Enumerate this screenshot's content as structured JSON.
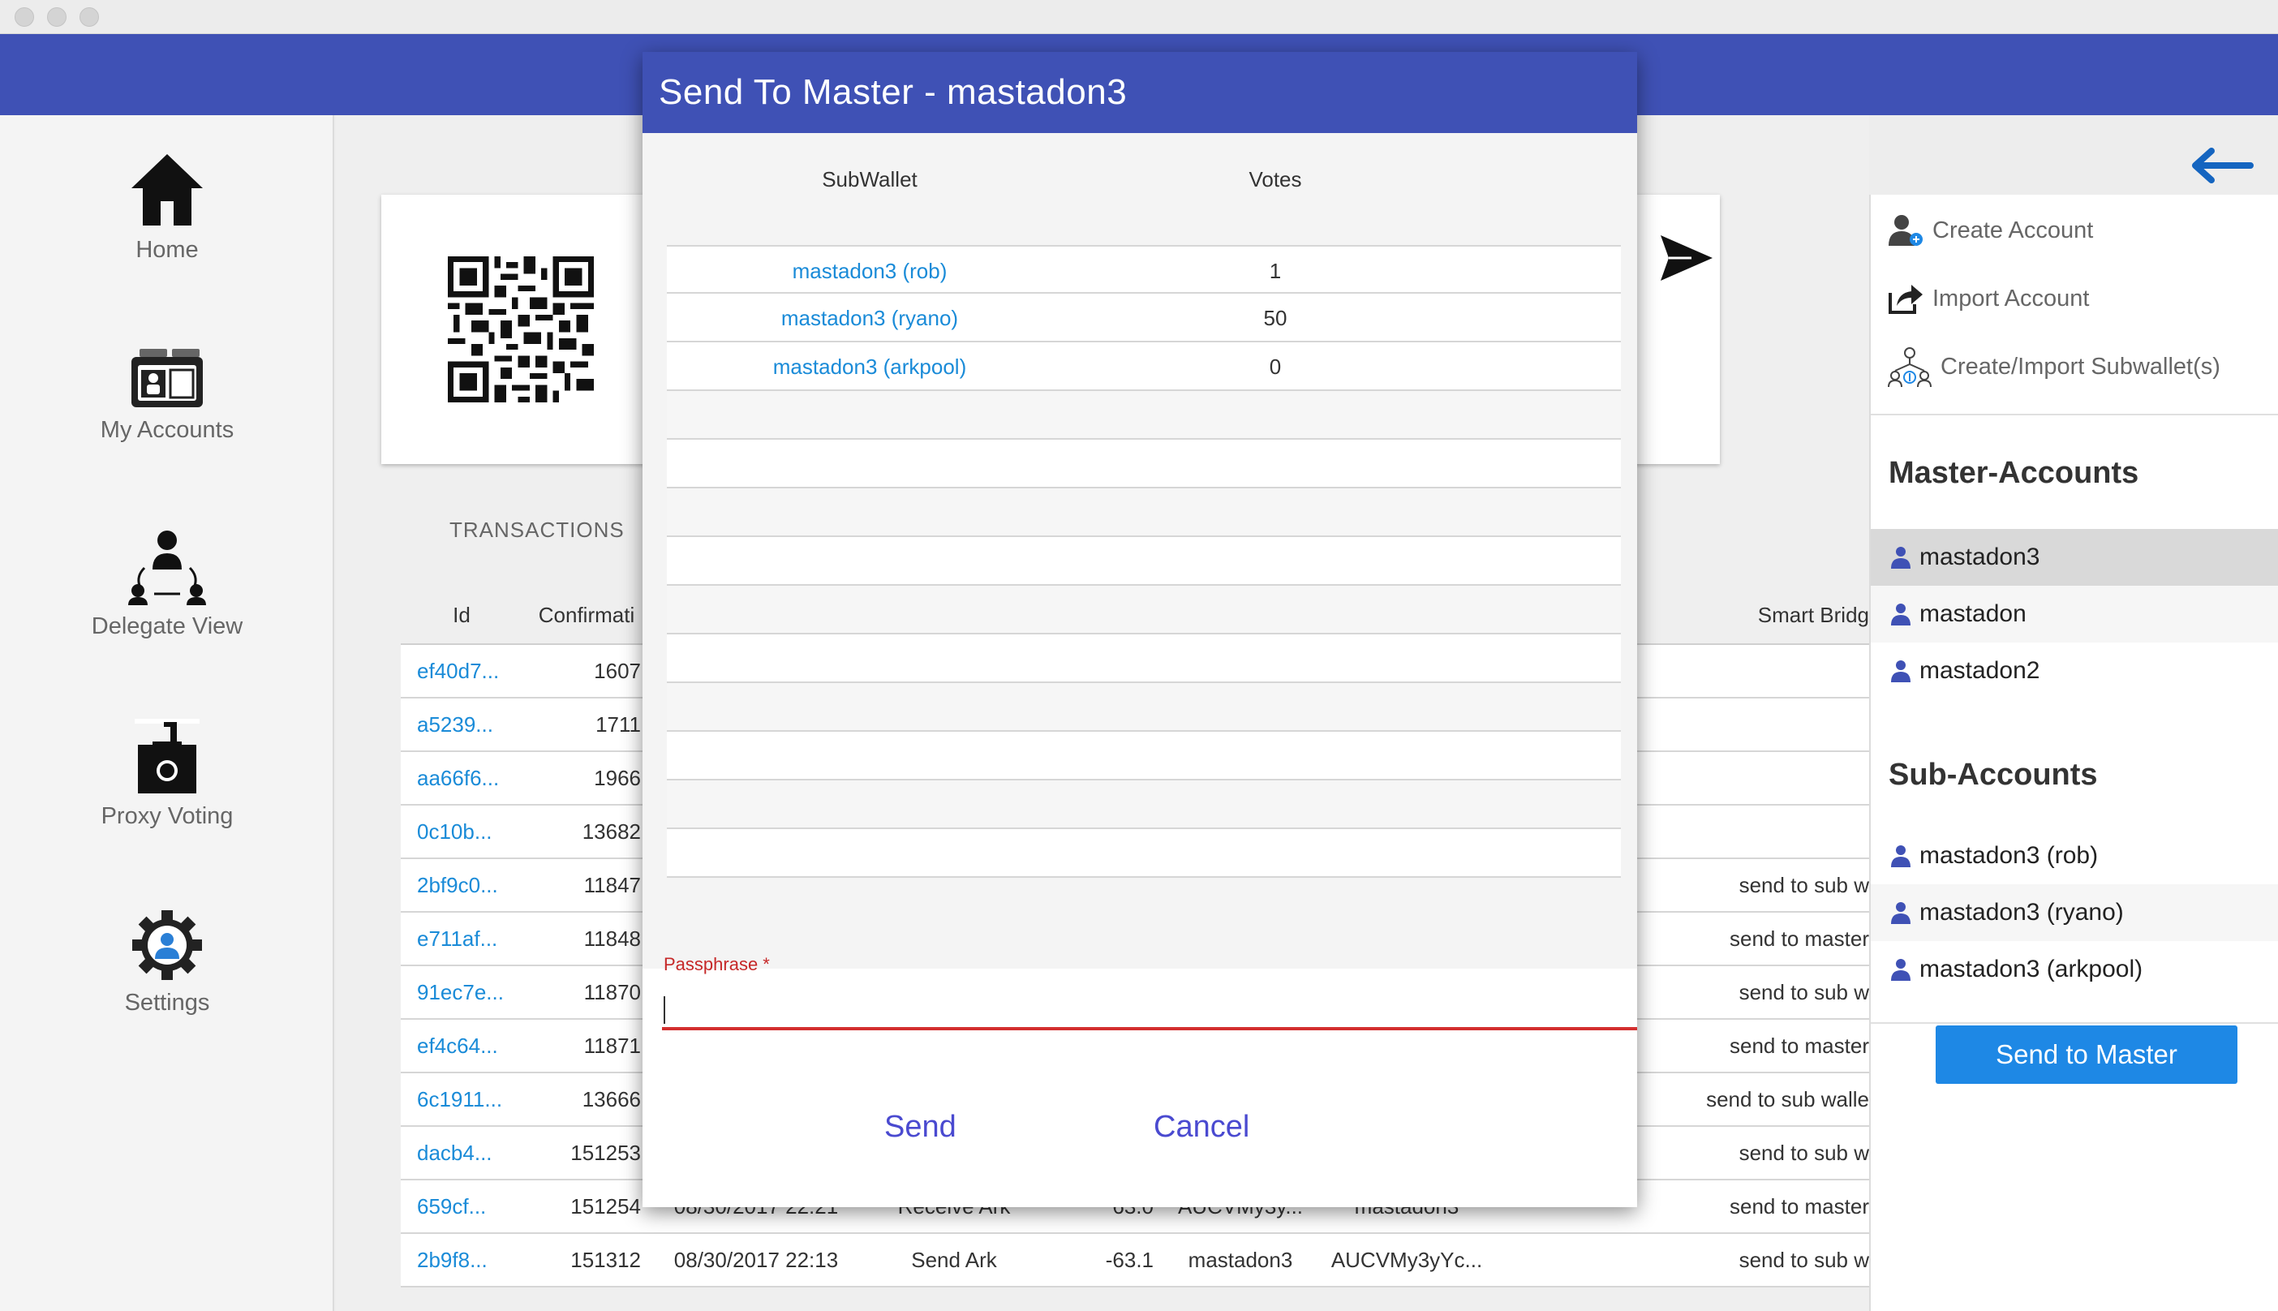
{
  "window": {
    "title": ""
  },
  "nav": [
    {
      "key": "home",
      "label": "Home",
      "icon": "house-icon"
    },
    {
      "key": "my-accounts",
      "label": "My Accounts",
      "icon": "id-card-icon"
    },
    {
      "key": "delegate-view",
      "label": "Delegate View",
      "icon": "delegate-network-icon"
    },
    {
      "key": "proxy-voting",
      "label": "Proxy Voting",
      "icon": "ballot-box-icon"
    },
    {
      "key": "settings",
      "label": "Settings",
      "icon": "gear-user-icon"
    }
  ],
  "main": {
    "transactions_title": "TRANSACTIONS",
    "columns": [
      "Id",
      "Confirmati",
      "",
      "",
      "",
      "",
      "",
      "Smart Bridg"
    ],
    "rows": [
      {
        "id": "ef40d7...",
        "conf": "1607",
        "date": "",
        "type": "",
        "amount": "",
        "from": "",
        "to": "",
        "bridge": ""
      },
      {
        "id": "a5239...",
        "conf": "1711",
        "date": "",
        "type": "",
        "amount": "",
        "from": "",
        "to": "",
        "bridge": ""
      },
      {
        "id": "aa66f6...",
        "conf": "1966",
        "date": "",
        "type": "",
        "amount": "",
        "from": "",
        "to": "",
        "bridge": ""
      },
      {
        "id": "0c10b...",
        "conf": "13682",
        "date": "",
        "type": "",
        "amount": "",
        "from": "",
        "to": "",
        "bridge": ""
      },
      {
        "id": "2bf9c0...",
        "conf": "11847",
        "date": "",
        "type": "",
        "amount": "",
        "from": "",
        "to": ".",
        "bridge": "send to sub w"
      },
      {
        "id": "e711af...",
        "conf": "11848",
        "date": "",
        "type": "",
        "amount": "",
        "from": "",
        "to": "",
        "bridge": "send to master"
      },
      {
        "id": "91ec7e...",
        "conf": "11870",
        "date": "",
        "type": "",
        "amount": "",
        "from": "",
        "to": ".",
        "bridge": "send to sub w"
      },
      {
        "id": "ef4c64...",
        "conf": "11871",
        "date": "",
        "type": "",
        "amount": "",
        "from": "",
        "to": "",
        "bridge": "send to master"
      },
      {
        "id": "6c1911...",
        "conf": "13666",
        "date": "",
        "type": "",
        "amount": "",
        "from": "",
        "to": "..",
        "bridge": "send to sub walle"
      },
      {
        "id": "dacb4...",
        "conf": "151253",
        "date": "",
        "type": "",
        "amount": "",
        "from": "",
        "to": ".",
        "bridge": "send to sub w"
      },
      {
        "id": "659cf...",
        "conf": "151254",
        "date": "08/30/2017 22:21",
        "type": "Receive Ark",
        "amount": "63.0",
        "from": "AUCVMy3y...",
        "to": "mastadon3",
        "bridge": "send to master"
      },
      {
        "id": "2b9f8...",
        "conf": "151312",
        "date": "08/30/2017 22:13",
        "type": "Send Ark",
        "amount": "-63.1",
        "from": "mastadon3",
        "to": "AUCVMy3yYc...",
        "bridge": "send to sub w"
      }
    ]
  },
  "right": {
    "actions": [
      {
        "label": "Create Account",
        "icon": "add-user-icon"
      },
      {
        "label": "Import Account",
        "icon": "share-export-icon"
      },
      {
        "label": "Create/Import Subwallet(s)",
        "icon": "subwallet-tree-icon"
      }
    ],
    "master_title": "Master-Accounts",
    "masters": [
      "mastadon3",
      "mastadon",
      "mastadon2"
    ],
    "sub_title": "Sub-Accounts",
    "subs": [
      "mastadon3 (rob)",
      "mastadon3 (ryano)",
      "mastadon3 (arkpool)"
    ],
    "send_button": "Send to Master"
  },
  "modal": {
    "title": "Send To Master - mastadon3",
    "col_subwallet": "SubWallet",
    "col_votes": "Votes",
    "rows": [
      {
        "name": "mastadon3 (rob)",
        "votes": "1"
      },
      {
        "name": "mastadon3 (ryano)",
        "votes": "50"
      },
      {
        "name": "mastadon3 (arkpool)",
        "votes": "0"
      }
    ],
    "passphrase_label": "Passphrase *",
    "passphrase_value": "",
    "send_label": "Send",
    "cancel_label": "Cancel"
  },
  "colors": {
    "primary": "#3f51b5",
    "accent": "#1e88e5",
    "link": "#1a8bd8",
    "error": "#d32f2f",
    "dialog_button": "#4a4ad0"
  }
}
